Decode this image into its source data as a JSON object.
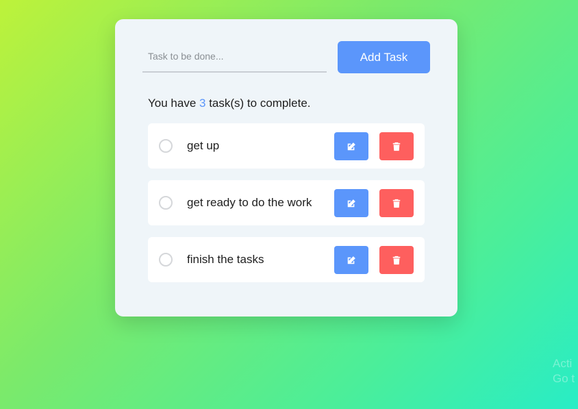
{
  "form": {
    "input_placeholder": "Task to be done...",
    "add_label": "Add Task"
  },
  "summary": {
    "prefix": "You have ",
    "count": "3",
    "suffix": " task(s) to complete."
  },
  "tasks": [
    {
      "text": "get up"
    },
    {
      "text": "get ready to do the work"
    },
    {
      "text": "finish the tasks"
    }
  ],
  "icons": {
    "edit": "edit-icon",
    "delete": "trash-icon"
  },
  "colors": {
    "accent": "#5b96fb",
    "danger": "#fe5f5e",
    "card": "#eff5f9"
  },
  "watermark": {
    "line1": "Acti",
    "line2": "Go t"
  }
}
